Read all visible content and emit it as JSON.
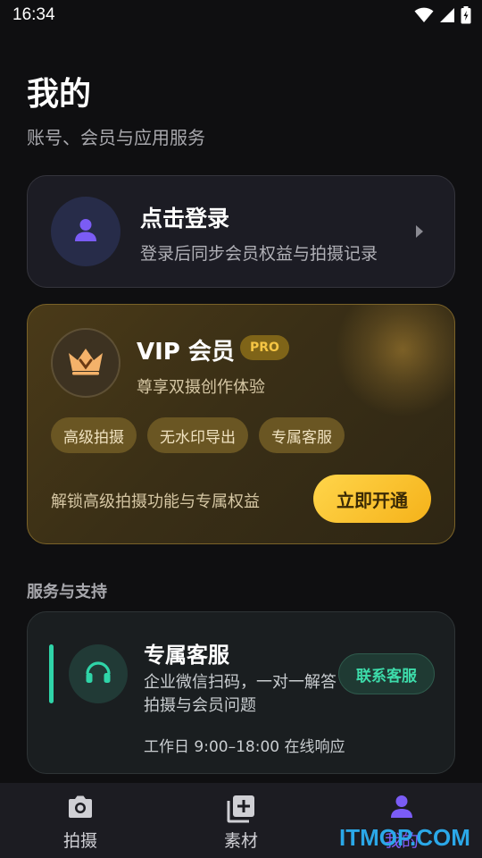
{
  "status_bar": {
    "time": "16:34",
    "icons": [
      "wifi-icon",
      "signal-icon",
      "battery-charging-icon"
    ]
  },
  "header": {
    "title": "我的",
    "subtitle": "账号、会员与应用服务"
  },
  "login_card": {
    "title": "点击登录",
    "subtitle": "登录后同步会员权益与拍摄记录",
    "avatar_icon": "user-icon",
    "arrow_icon": "chevron-right-icon"
  },
  "vip_card": {
    "title": "VIP 会员",
    "badge": "PRO",
    "subtitle": "尊享双摄创作体验",
    "perks": [
      "高级拍摄",
      "无水印导出",
      "专属客服"
    ],
    "hint": "解锁高级拍摄功能与专属权益",
    "button_label": "立即开通",
    "icon": "crown-icon",
    "colors": {
      "accent": "#f5c544",
      "button": "#ffc833"
    }
  },
  "services": {
    "section_title": "服务与支持",
    "card": {
      "title": "专属客服",
      "description": "企业微信扫码，一对一解答拍摄与会员问题",
      "button_label": "联系客服",
      "hours": "工作日 9:00–18:00 在线响应",
      "icon": "headset-icon",
      "accent_color": "#2fd4a8"
    }
  },
  "bottom_nav": {
    "items": [
      {
        "label": "拍摄",
        "icon": "camera-icon",
        "active": false
      },
      {
        "label": "素材",
        "icon": "add-media-icon",
        "active": false
      },
      {
        "label": "我的",
        "icon": "user-icon",
        "active": true
      }
    ],
    "active_color": "#7b5cf5"
  },
  "watermark": "ITMOP.COM"
}
